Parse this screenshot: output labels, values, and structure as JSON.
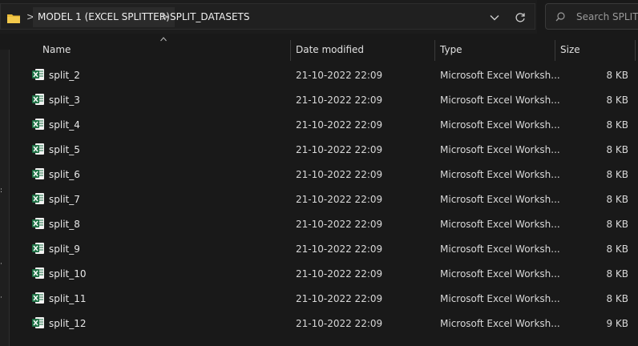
{
  "address": {
    "breadcrumbs": [
      "MODEL 1 (EXCEL SPLITTER)",
      "SPLIT_DATASETS"
    ],
    "separator": ">"
  },
  "search": {
    "placeholder": "Search SPLIT_D"
  },
  "columns": {
    "name": "Name",
    "date": "Date modified",
    "type": "Type",
    "size": "Size"
  },
  "files": [
    {
      "name": "split_2",
      "date": "21-10-2022 22:09",
      "type": "Microsoft Excel Worksh...",
      "size": "8 KB"
    },
    {
      "name": "split_3",
      "date": "21-10-2022 22:09",
      "type": "Microsoft Excel Worksh...",
      "size": "8 KB"
    },
    {
      "name": "split_4",
      "date": "21-10-2022 22:09",
      "type": "Microsoft Excel Worksh...",
      "size": "8 KB"
    },
    {
      "name": "split_5",
      "date": "21-10-2022 22:09",
      "type": "Microsoft Excel Worksh...",
      "size": "8 KB"
    },
    {
      "name": "split_6",
      "date": "21-10-2022 22:09",
      "type": "Microsoft Excel Worksh...",
      "size": "8 KB"
    },
    {
      "name": "split_7",
      "date": "21-10-2022 22:09",
      "type": "Microsoft Excel Worksh...",
      "size": "8 KB"
    },
    {
      "name": "split_8",
      "date": "21-10-2022 22:09",
      "type": "Microsoft Excel Worksh...",
      "size": "8 KB"
    },
    {
      "name": "split_9",
      "date": "21-10-2022 22:09",
      "type": "Microsoft Excel Worksh...",
      "size": "8 KB"
    },
    {
      "name": "split_10",
      "date": "21-10-2022 22:09",
      "type": "Microsoft Excel Worksh...",
      "size": "8 KB"
    },
    {
      "name": "split_11",
      "date": "21-10-2022 22:09",
      "type": "Microsoft Excel Worksh...",
      "size": "8 KB"
    },
    {
      "name": "split_12",
      "date": "21-10-2022 22:09",
      "type": "Microsoft Excel Worksh...",
      "size": "9 KB"
    }
  ],
  "colors": {
    "background": "#191919",
    "excel_green": "#1e7145",
    "folder_yellow": "#e8b938"
  },
  "icons": {
    "folder": "folder-icon",
    "file": "excel-file-icon",
    "refresh": "refresh-icon",
    "search": "search-icon",
    "dropdown": "chevron-down-icon",
    "sort": "sort-ascending-icon"
  }
}
